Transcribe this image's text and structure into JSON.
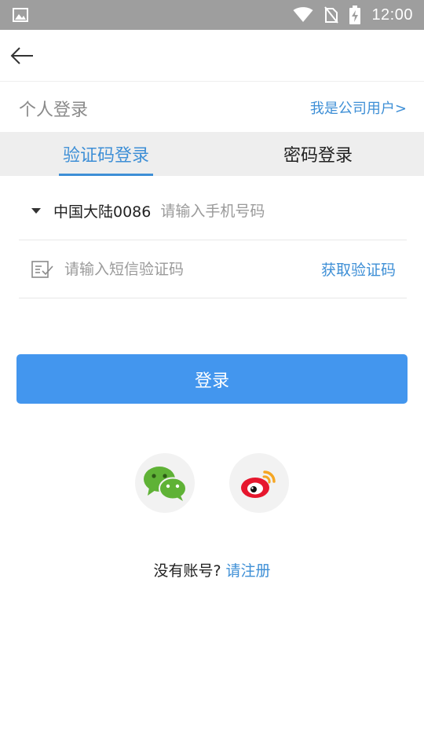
{
  "status_bar": {
    "time": "12:00",
    "icons": [
      "image-icon",
      "wifi-icon",
      "no-sim-icon",
      "battery-charging-icon"
    ]
  },
  "nav": {
    "back_icon": "arrow-left-icon"
  },
  "login_type": {
    "title": "个人登录",
    "company_link": "我是公司用户>"
  },
  "tabs": [
    {
      "label": "验证码登录",
      "active": true
    },
    {
      "label": "密码登录",
      "active": false
    }
  ],
  "form": {
    "country_code": "中国大陆0086",
    "phone_placeholder": "请输入手机号码",
    "phone_value": "",
    "code_icon": "edit-check-icon",
    "code_placeholder": "请输入短信验证码",
    "code_value": "",
    "get_code_label": "获取验证码"
  },
  "login_button": "登录",
  "social": [
    {
      "name": "wechat",
      "icon": "wechat-icon"
    },
    {
      "name": "weibo",
      "icon": "weibo-icon"
    }
  ],
  "register": {
    "question": "没有账号?",
    "link": "请注册"
  },
  "colors": {
    "accent": "#3e8fd6",
    "button": "#4396ee",
    "status_bar": "#9e9e9e",
    "tab_bg": "#eeeeee",
    "wechat": "#5fb236",
    "weibo": "#e6162d"
  }
}
